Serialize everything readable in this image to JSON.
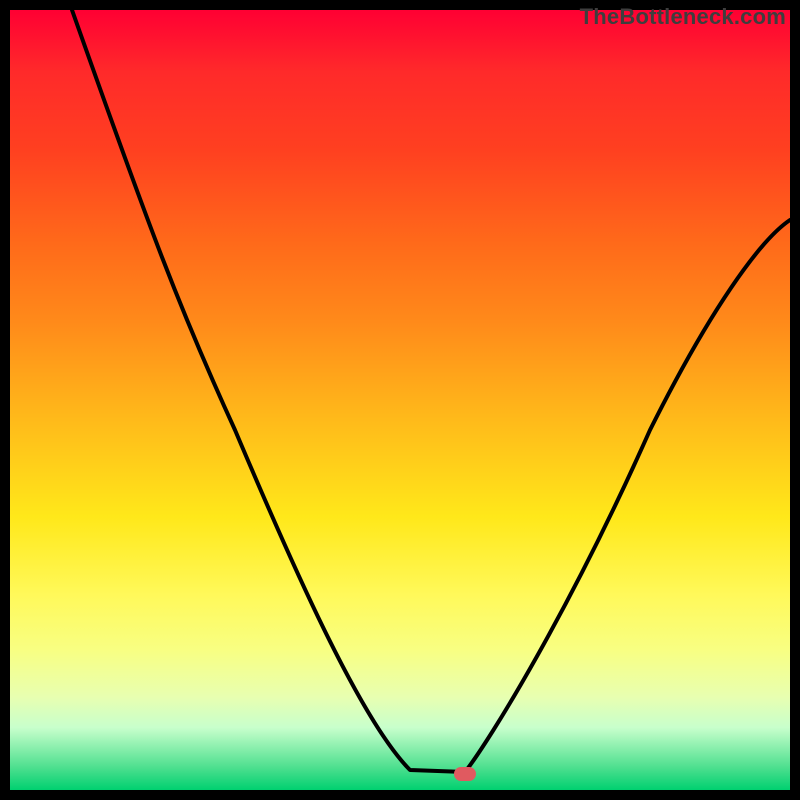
{
  "watermark": "TheBottleneck.com",
  "colors": {
    "gradient_top": "#ff0033",
    "gradient_bottom": "#00d070",
    "curve": "#000000",
    "marker": "#e05a60",
    "frame": "#000000"
  },
  "chart_data": {
    "type": "line",
    "title": "",
    "xlabel": "",
    "ylabel": "",
    "xlim": [
      0,
      100
    ],
    "ylim": [
      0,
      100
    ],
    "series": [
      {
        "name": "bottleneck-curve",
        "x": [
          8,
          15,
          22,
          29,
          36,
          43,
          51,
          55,
          58,
          62,
          70,
          78,
          86,
          94,
          100
        ],
        "y": [
          100,
          78,
          62,
          50,
          38,
          26,
          8,
          2,
          2,
          6,
          20,
          40,
          58,
          70,
          73
        ]
      }
    ],
    "annotations": [
      {
        "name": "optimal-point",
        "x": 57,
        "y": 2
      }
    ],
    "legend": false,
    "grid": false
  }
}
